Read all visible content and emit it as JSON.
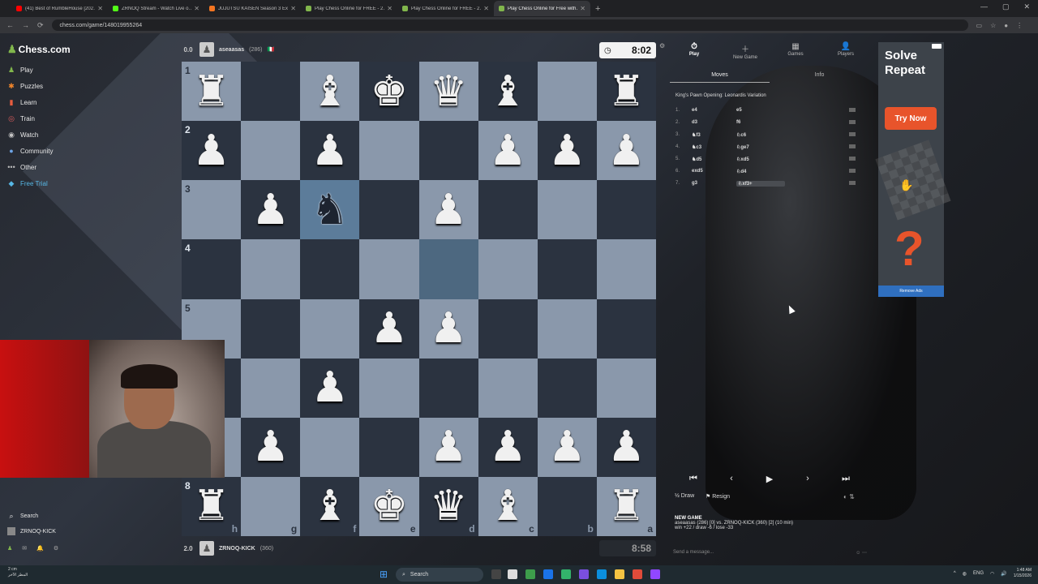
{
  "browser": {
    "tabs": [
      {
        "title": "(41) Best of RumbleHouse [202…",
        "color": "#ff0000"
      },
      {
        "title": "ZRNOQ Stream - Watch Live o…",
        "color": "#53fc18"
      },
      {
        "title": "JUJUTSU KAISEN Season 3 Exe…",
        "color": "#f47521"
      },
      {
        "title": "Play Chess Online for FREE - 2…",
        "color": "#81b64c"
      },
      {
        "title": "Play Chess Online for FREE - 2…",
        "color": "#81b64c"
      },
      {
        "title": "Play Chess Online for Free with…",
        "color": "#81b64c"
      }
    ],
    "new_tab": "+",
    "url": "chess.com/game/148019955264",
    "window_controls": [
      "—",
      "▢",
      "✕"
    ]
  },
  "sidebar": {
    "logo": "Chess.com",
    "items": [
      {
        "label": "Play",
        "icon": "♟",
        "color": "#81b64c"
      },
      {
        "label": "Puzzles",
        "icon": "✱",
        "color": "#f1862b"
      },
      {
        "label": "Learn",
        "icon": "▮",
        "color": "#e85d3f"
      },
      {
        "label": "Train",
        "icon": "◎",
        "color": "#e05d5d"
      },
      {
        "label": "Watch",
        "icon": "◉",
        "color": "#c3c3c3"
      },
      {
        "label": "Community",
        "icon": "●",
        "color": "#6ea4e6"
      },
      {
        "label": "Other",
        "icon": "•••",
        "color": "#bbbbbb"
      },
      {
        "label": "Free Trial",
        "icon": "◆",
        "color": "#57b8e6"
      }
    ],
    "bottom": {
      "search": "Search",
      "user": "ZRNOQ-KICK"
    }
  },
  "game": {
    "top_player": {
      "score": "0.0",
      "name": "aseaasas",
      "rating": "(286)",
      "flag": "🇮🇹",
      "clock": "8:02"
    },
    "bottom_player": {
      "score": "2.0",
      "name": "ZRNOQ-KICK",
      "rating": "(360)",
      "clock": "8:58",
      "sub": "+3"
    },
    "ranks": [
      "1",
      "2",
      "3",
      "4",
      "5",
      "6",
      "7",
      "8"
    ],
    "files": [
      "h",
      "g",
      "f",
      "e",
      "d",
      "c",
      "b",
      "a"
    ],
    "board": [
      [
        "wR",
        "",
        "wB",
        "wK",
        "wQ",
        "wB",
        "",
        "wR"
      ],
      [
        "wP",
        "",
        "wP",
        "",
        "",
        "wP",
        "wP",
        "wP"
      ],
      [
        "",
        "wP",
        "bN",
        "",
        "wP",
        "",
        "",
        ""
      ],
      [
        "",
        "",
        "",
        "",
        "",
        "",
        "",
        ""
      ],
      [
        "",
        "",
        "",
        "wP",
        "wP",
        "",
        "",
        ""
      ],
      [
        "",
        "",
        "wP",
        "",
        "",
        "",
        "",
        ""
      ],
      [
        "",
        "wP",
        "",
        "",
        "wP",
        "wP",
        "wP",
        "wP"
      ],
      [
        "wR",
        "",
        "wB",
        "wK",
        "wQ",
        "wB",
        "",
        "wR"
      ]
    ],
    "highlights": [
      "2-2",
      "3-4"
    ]
  },
  "panel": {
    "nav": [
      {
        "label": "Play",
        "icon": "⏱"
      },
      {
        "label": "New Game",
        "icon": "＋"
      },
      {
        "label": "Games",
        "icon": "▦"
      },
      {
        "label": "Players",
        "icon": "👤"
      }
    ],
    "tab_moves": "Moves",
    "tab_info": "Info",
    "opening": "King's Pawn Opening: Leonardis Variation",
    "moves": [
      {
        "n": "1.",
        "w": "e4",
        "b": "e5"
      },
      {
        "n": "2.",
        "w": "d3",
        "b": "f6"
      },
      {
        "n": "3.",
        "w": "♞f3",
        "b": "♘c6"
      },
      {
        "n": "4.",
        "w": "♞c3",
        "b": "♘ge7"
      },
      {
        "n": "5.",
        "w": "♞d5",
        "b": "♘xd5"
      },
      {
        "n": "6.",
        "w": "exd5",
        "b": "♘d4"
      },
      {
        "n": "7.",
        "w": "g3",
        "b": "♘xf3+"
      }
    ],
    "controls": [
      "⏮",
      "‹",
      "▶",
      "›",
      "⏭"
    ],
    "draw": "Draw",
    "resign": "Resign",
    "new_game_title": "NEW GAME",
    "new_game_line1": "aseaasas (286) [0] vs. ZRNOQ-KICK (360) [2] (10 min)",
    "new_game_line2": "win +22 / draw -6 / lose -33",
    "chat_placeholder": "Send a message..."
  },
  "ad": {
    "title": "Solve Repeat",
    "button": "Try Now",
    "remove": "Remove Ads"
  },
  "taskbar": {
    "weather_temp": "2 cm",
    "weather_desc": "المطر الآخر",
    "search": "Search",
    "lang": "ENG",
    "time": "1:48 AM",
    "date": "1/15/2026"
  }
}
